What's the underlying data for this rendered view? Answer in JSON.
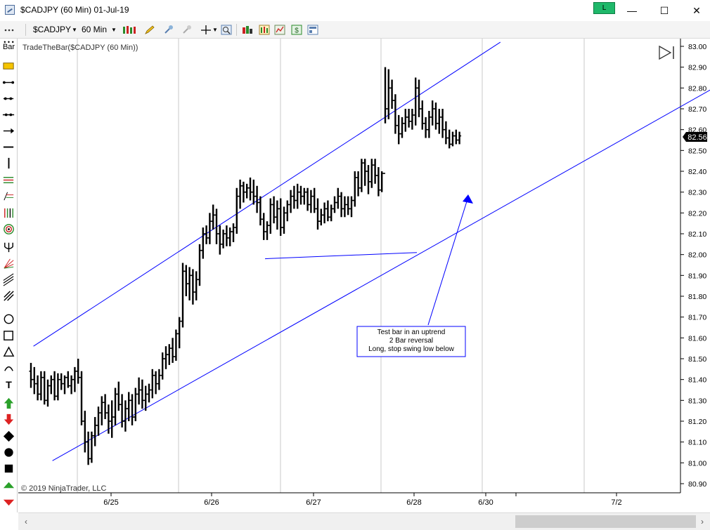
{
  "window": {
    "title": "$CADJPY (60 Min)  01-Jul-19",
    "link_label": "L",
    "minimize": "—",
    "maximize": "☐",
    "close": "✕"
  },
  "toolbar": {
    "instrument": "$CADJPY",
    "interval": "60 Min"
  },
  "sidebar": {
    "bar_label": "Bar",
    "tools": [
      "ruler-icon",
      "line-icon",
      "ray-icon",
      "extended-line-icon",
      "arrow-line-icon",
      "horizontal-line-icon",
      "vertical-line-icon",
      "fibonacci-retracement-icon",
      "fibonacci-extension-icon",
      "fibonacci-timezones-icon",
      "fibonacci-circle-icon",
      "andrews-pitchfork-icon",
      "gann-fan-icon",
      "regression-channel-icon",
      "trend-channel-icon",
      "ellipse-icon",
      "rectangle-icon",
      "triangle-icon",
      "arc-icon",
      "text-icon",
      "arrow-up-icon",
      "arrow-down-icon",
      "diamond-icon",
      "dot-icon",
      "square-icon",
      "triangle-up-icon",
      "triangle-down-icon"
    ]
  },
  "chart": {
    "label": "TradeTheBar($CADJPY (60 Min))",
    "copyright": "© 2019 NinjaTrader, LLC",
    "last_price": "82.56",
    "annotation": [
      "Test bar in an uptrend",
      "2 Bar reversal",
      "Long, stop swing low below"
    ],
    "colors": {
      "bars": "#000000",
      "channel": "#0000ff",
      "grid": "#c8c8c8",
      "price_tag": "#000000"
    }
  },
  "chart_data": {
    "type": "bar",
    "ylim": [
      80.87,
      83.03
    ],
    "y_ticks": [
      "83.00",
      "82.90",
      "82.80",
      "82.70",
      "82.60",
      "82.50",
      "82.40",
      "82.30",
      "82.20",
      "82.10",
      "82.00",
      "81.90",
      "81.80",
      "81.70",
      "81.60",
      "81.50",
      "81.40",
      "81.30",
      "81.20",
      "81.10",
      "81.00",
      "80.90"
    ],
    "x_ticks": [
      "6/25",
      "6/26",
      "6/27",
      "6/28",
      "6/30",
      "7/2"
    ],
    "series": [
      {
        "values": [
          [
            81.44,
            81.48,
            81.36,
            81.4
          ],
          [
            81.4,
            81.46,
            81.33,
            81.38
          ],
          [
            81.38,
            81.42,
            81.3,
            81.33
          ],
          [
            81.33,
            81.44,
            81.3,
            81.41
          ],
          [
            81.41,
            81.44,
            81.28,
            81.3
          ],
          [
            81.3,
            81.4,
            81.27,
            81.37
          ],
          [
            81.37,
            81.42,
            81.33,
            81.4
          ],
          [
            81.4,
            81.44,
            81.3,
            81.32
          ],
          [
            81.32,
            81.43,
            81.3,
            81.4
          ],
          [
            81.4,
            81.43,
            81.35,
            81.38
          ],
          [
            81.38,
            81.42,
            81.33,
            81.41
          ],
          [
            81.41,
            81.44,
            81.36,
            81.37
          ],
          [
            81.37,
            81.42,
            81.33,
            81.4
          ],
          [
            81.4,
            81.46,
            81.34,
            81.44
          ],
          [
            81.44,
            81.5,
            81.38,
            81.41
          ],
          [
            81.41,
            81.44,
            81.18,
            81.2
          ],
          [
            81.2,
            81.25,
            81.05,
            81.1
          ],
          [
            81.1,
            81.15,
            80.99,
            81.02
          ],
          [
            81.02,
            81.15,
            81.0,
            81.13
          ],
          [
            81.13,
            81.22,
            81.08,
            81.18
          ],
          [
            81.18,
            81.27,
            81.13,
            81.24
          ],
          [
            81.24,
            81.32,
            81.18,
            81.29
          ],
          [
            81.29,
            81.33,
            81.21,
            81.24
          ],
          [
            81.24,
            81.28,
            81.14,
            81.2
          ],
          [
            81.2,
            81.3,
            81.12,
            81.22
          ],
          [
            81.22,
            81.36,
            81.18,
            81.33
          ],
          [
            81.33,
            81.39,
            81.25,
            81.28
          ],
          [
            81.28,
            81.33,
            81.17,
            81.2
          ],
          [
            81.2,
            81.3,
            81.15,
            81.26
          ],
          [
            81.26,
            81.34,
            81.2,
            81.3
          ],
          [
            81.3,
            81.33,
            81.18,
            81.22
          ],
          [
            81.22,
            81.36,
            81.2,
            81.33
          ],
          [
            81.33,
            81.41,
            81.28,
            81.35
          ],
          [
            81.35,
            81.4,
            81.26,
            81.3
          ],
          [
            81.3,
            81.37,
            81.25,
            81.33
          ],
          [
            81.33,
            81.38,
            81.29,
            81.35
          ],
          [
            81.35,
            81.45,
            81.31,
            81.42
          ],
          [
            81.42,
            81.44,
            81.33,
            81.38
          ],
          [
            81.38,
            81.45,
            81.35,
            81.42
          ],
          [
            81.42,
            81.53,
            81.4,
            81.5
          ],
          [
            81.5,
            81.56,
            81.45,
            81.52
          ],
          [
            81.52,
            81.57,
            81.47,
            81.55
          ],
          [
            81.55,
            81.6,
            81.48,
            81.51
          ],
          [
            81.51,
            81.64,
            81.49,
            81.62
          ],
          [
            81.62,
            81.7,
            81.55,
            81.68
          ],
          [
            81.68,
            81.96,
            81.65,
            81.92
          ],
          [
            81.92,
            81.95,
            81.8,
            81.86
          ],
          [
            81.86,
            81.94,
            81.78,
            81.9
          ],
          [
            81.9,
            81.93,
            81.76,
            81.82
          ],
          [
            81.82,
            81.92,
            81.78,
            81.88
          ],
          [
            81.88,
            82.05,
            81.85,
            82.02
          ],
          [
            82.02,
            82.13,
            81.98,
            82.1
          ],
          [
            82.1,
            82.14,
            82.05,
            82.08
          ],
          [
            82.08,
            82.2,
            82.05,
            82.16
          ],
          [
            82.16,
            82.24,
            82.12,
            82.19
          ],
          [
            82.19,
            82.22,
            82.05,
            82.1
          ],
          [
            82.1,
            82.14,
            82.0,
            82.05
          ],
          [
            82.05,
            82.12,
            82.03,
            82.1
          ],
          [
            82.1,
            82.14,
            82.04,
            82.08
          ],
          [
            82.08,
            82.13,
            82.04,
            82.11
          ],
          [
            82.11,
            82.15,
            82.06,
            82.13
          ],
          [
            82.13,
            82.32,
            82.1,
            82.28
          ],
          [
            82.28,
            82.36,
            82.22,
            82.33
          ],
          [
            82.33,
            82.35,
            82.25,
            82.3
          ],
          [
            82.3,
            82.34,
            82.27,
            82.32
          ],
          [
            82.32,
            82.37,
            82.26,
            82.3
          ],
          [
            82.3,
            82.36,
            82.24,
            82.28
          ],
          [
            82.28,
            82.33,
            82.2,
            82.25
          ],
          [
            82.25,
            82.28,
            82.14,
            82.17
          ],
          [
            82.17,
            82.2,
            82.07,
            82.11
          ],
          [
            82.11,
            82.16,
            82.07,
            82.14
          ],
          [
            82.14,
            82.27,
            82.1,
            82.24
          ],
          [
            82.24,
            82.28,
            82.15,
            82.18
          ],
          [
            82.18,
            82.26,
            82.12,
            82.22
          ],
          [
            82.22,
            82.27,
            82.09,
            82.13
          ],
          [
            82.13,
            82.23,
            82.1,
            82.2
          ],
          [
            82.2,
            82.26,
            82.16,
            82.24
          ],
          [
            82.24,
            82.31,
            82.2,
            82.28
          ],
          [
            82.28,
            82.33,
            82.22,
            82.26
          ],
          [
            82.26,
            82.34,
            82.22,
            82.3
          ],
          [
            82.3,
            82.33,
            82.24,
            82.28
          ],
          [
            82.28,
            82.32,
            82.24,
            82.3
          ],
          [
            82.3,
            82.32,
            82.21,
            82.24
          ],
          [
            82.24,
            82.31,
            82.2,
            82.28
          ],
          [
            82.28,
            82.32,
            82.2,
            82.22
          ],
          [
            82.22,
            82.27,
            82.12,
            82.16
          ],
          [
            82.16,
            82.22,
            82.14,
            82.19
          ],
          [
            82.19,
            82.25,
            82.15,
            82.22
          ],
          [
            82.22,
            82.26,
            82.16,
            82.18
          ],
          [
            82.18,
            82.24,
            82.16,
            82.22
          ],
          [
            82.22,
            82.28,
            82.2,
            82.25
          ],
          [
            82.25,
            82.32,
            82.22,
            82.28
          ],
          [
            82.28,
            82.3,
            82.18,
            82.22
          ],
          [
            82.22,
            82.28,
            82.18,
            82.24
          ],
          [
            82.24,
            82.28,
            82.19,
            82.22
          ],
          [
            82.22,
            82.28,
            82.18,
            82.26
          ],
          [
            82.26,
            82.4,
            82.23,
            82.37
          ],
          [
            82.37,
            82.4,
            82.28,
            82.32
          ],
          [
            82.32,
            82.46,
            82.3,
            82.44
          ],
          [
            82.44,
            82.46,
            82.33,
            82.4
          ],
          [
            82.4,
            82.43,
            82.29,
            82.35
          ],
          [
            82.35,
            82.46,
            82.32,
            82.43
          ],
          [
            82.43,
            82.46,
            82.34,
            82.38
          ],
          [
            82.38,
            82.42,
            82.28,
            82.31
          ],
          [
            82.31,
            82.4,
            82.3,
            82.39
          ],
          [
            82.39,
            82.9,
            82.63,
            82.7
          ],
          [
            82.7,
            82.89,
            82.65,
            82.8
          ],
          [
            82.8,
            82.84,
            82.7,
            82.74
          ],
          [
            82.74,
            82.77,
            82.58,
            82.62
          ],
          [
            82.62,
            82.67,
            82.53,
            82.58
          ],
          [
            82.58,
            82.66,
            82.56,
            82.63
          ],
          [
            82.63,
            82.7,
            82.59,
            82.66
          ],
          [
            82.66,
            82.7,
            82.61,
            82.64
          ],
          [
            82.64,
            82.7,
            82.6,
            82.67
          ],
          [
            82.67,
            82.85,
            82.62,
            82.8
          ],
          [
            82.8,
            82.84,
            82.66,
            82.7
          ],
          [
            82.7,
            82.74,
            82.6,
            82.63
          ],
          [
            82.63,
            82.66,
            82.56,
            82.6
          ],
          [
            82.6,
            82.69,
            82.56,
            82.66
          ],
          [
            82.66,
            82.74,
            82.62,
            82.7
          ],
          [
            82.7,
            82.73,
            82.6,
            82.63
          ],
          [
            82.63,
            82.7,
            82.58,
            82.66
          ],
          [
            82.66,
            82.7,
            82.56,
            82.6
          ],
          [
            82.6,
            82.64,
            82.53,
            82.56
          ],
          [
            82.56,
            82.6,
            82.51,
            82.53
          ],
          [
            82.53,
            82.59,
            82.52,
            82.57
          ],
          [
            82.57,
            82.6,
            82.53,
            82.55
          ],
          [
            82.55,
            82.59,
            82.53,
            82.57
          ]
        ]
      }
    ],
    "channel": {
      "upper": [
        [
          0.04,
          81.56
        ],
        [
          1.27,
          83.02
        ]
      ],
      "lower": [
        [
          0.09,
          81.01
        ],
        [
          1.9,
          82.87
        ]
      ],
      "horizontal": [
        [
          0.65,
          81.98
        ],
        [
          1.05,
          82.01
        ]
      ]
    }
  }
}
